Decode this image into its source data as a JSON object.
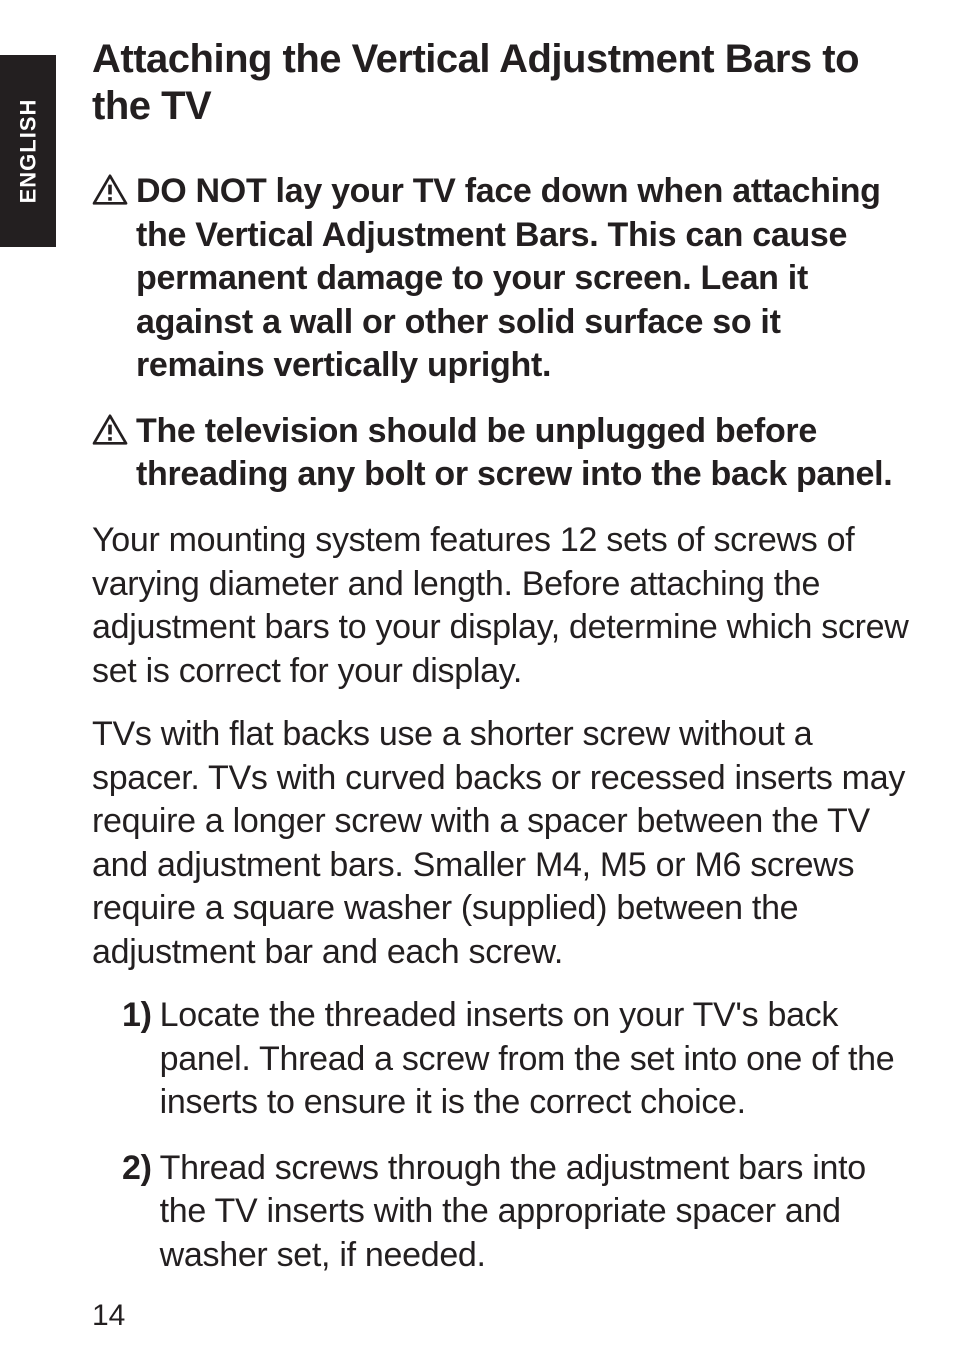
{
  "language_tab": "ENGLISH",
  "heading": "Attaching the Vertical Adjustment Bars to the TV",
  "warnings": [
    "DO NOT lay your TV face down when attaching the Vertical Adjustment Bars. This can cause permanent damage to your screen. Lean it against a wall or other solid surface so it remains vertically upright.",
    "The television should be unplugged before threading any bolt or screw into the back panel."
  ],
  "paragraphs": [
    "Your mounting system features 12 sets of screws of varying diameter and length. Before attaching the adjustment bars to your display, determine which screw set is correct for your display.",
    "TVs with flat backs use a shorter screw without a spacer. TVs with curved backs or recessed inserts may require a longer screw with a spacer between the TV and adjustment bars. Smaller M4, M5 or M6 screws require a square washer (supplied) between the adjustment bar and each screw."
  ],
  "list": [
    {
      "num": "1)",
      "text": "Locate the threaded inserts on your TV's back panel. Thread a screw from the set into one of the inserts to ensure it is the correct choice."
    },
    {
      "num": "2)",
      "text": "Thread screws through the adjustment bars into the TV inserts with the appropriate spacer and washer set, if needed."
    }
  ],
  "page_number": "14"
}
